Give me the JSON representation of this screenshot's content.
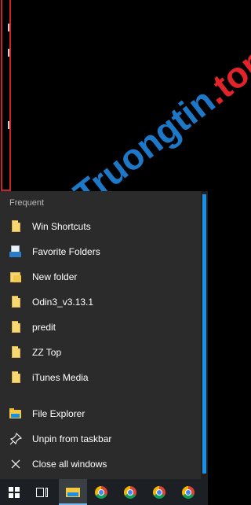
{
  "watermark": {
    "part1": "Truongtin",
    "part2": ".top"
  },
  "jumplist": {
    "section_title": "Frequent",
    "frequent": [
      {
        "label": "Win Shortcuts",
        "icon": "document-icon"
      },
      {
        "label": "Favorite Folders",
        "icon": "favorites-icon"
      },
      {
        "label": "New folder",
        "icon": "document-icon"
      },
      {
        "label": "Odin3_v3.13.1",
        "icon": "document-icon"
      },
      {
        "label": "predit",
        "icon": "document-icon"
      },
      {
        "label": "ZZ Top",
        "icon": "document-icon"
      },
      {
        "label": "iTunes Media",
        "icon": "document-icon"
      }
    ],
    "tasks": [
      {
        "label": "File Explorer",
        "icon": "folder-icon"
      },
      {
        "label": "Unpin from taskbar",
        "icon": "unpin-icon"
      },
      {
        "label": "Close all windows",
        "icon": "close-icon"
      }
    ]
  },
  "taskbar": {
    "items": [
      {
        "name": "start",
        "icon": "windows-logo-icon"
      },
      {
        "name": "task-view",
        "icon": "task-view-icon"
      },
      {
        "name": "file-explorer",
        "icon": "folder-icon",
        "active": true
      },
      {
        "name": "chrome-1",
        "icon": "chrome-icon"
      },
      {
        "name": "chrome-2",
        "icon": "chrome-icon"
      },
      {
        "name": "chrome-3",
        "icon": "chrome-icon"
      },
      {
        "name": "chrome-4",
        "icon": "chrome-icon"
      }
    ]
  },
  "colors": {
    "accent": "#1a8fe6",
    "menu_bg": "#2b2b2b",
    "taskbar_bg": "#1c2024",
    "frame_red": "#c8262c"
  }
}
